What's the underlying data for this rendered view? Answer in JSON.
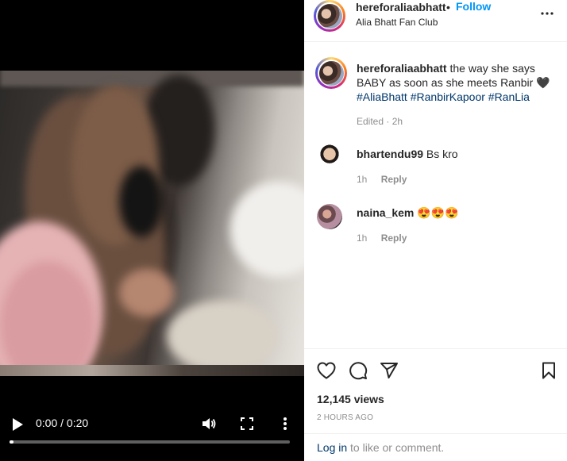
{
  "video": {
    "time_display": "0:00 / 0:20",
    "progress": 0.015
  },
  "header": {
    "username": "hereforaliaabhatt",
    "separator": "•",
    "follow_label": "Follow",
    "location": "Alia Bhatt Fan Club"
  },
  "caption": {
    "username": "hereforaliaabhatt",
    "text": "the way she says BABY as soon as she meets Ranbir 🖤",
    "hashtags": [
      "#AliaBhatt",
      "#RanbirKapoor",
      "#RanLia"
    ],
    "meta": "Edited · 2h"
  },
  "comments": [
    {
      "username": "bhartendu99",
      "text": "Bs kro",
      "time": "1h",
      "reply_label": "Reply"
    },
    {
      "username": "naina_kem",
      "text": "😍😍😍",
      "time": "1h",
      "reply_label": "Reply"
    }
  ],
  "stats": {
    "views": "12,145 views",
    "timestamp": "2 HOURS AGO"
  },
  "login": {
    "link_label": "Log in",
    "suffix": " to like or comment."
  },
  "icons": {
    "play": "play-icon",
    "volume": "volume-icon",
    "fullscreen": "fullscreen-icon",
    "more": "more-vertical-icon",
    "header_more": "more-horizontal-icon",
    "like": "heart-icon",
    "comment": "speech-bubble-icon",
    "share": "paper-plane-icon",
    "save": "bookmark-icon"
  },
  "colors": {
    "follow_blue": "#0095f6",
    "hashtag_navy": "#00376b",
    "muted_gray": "#8e8e8e"
  }
}
